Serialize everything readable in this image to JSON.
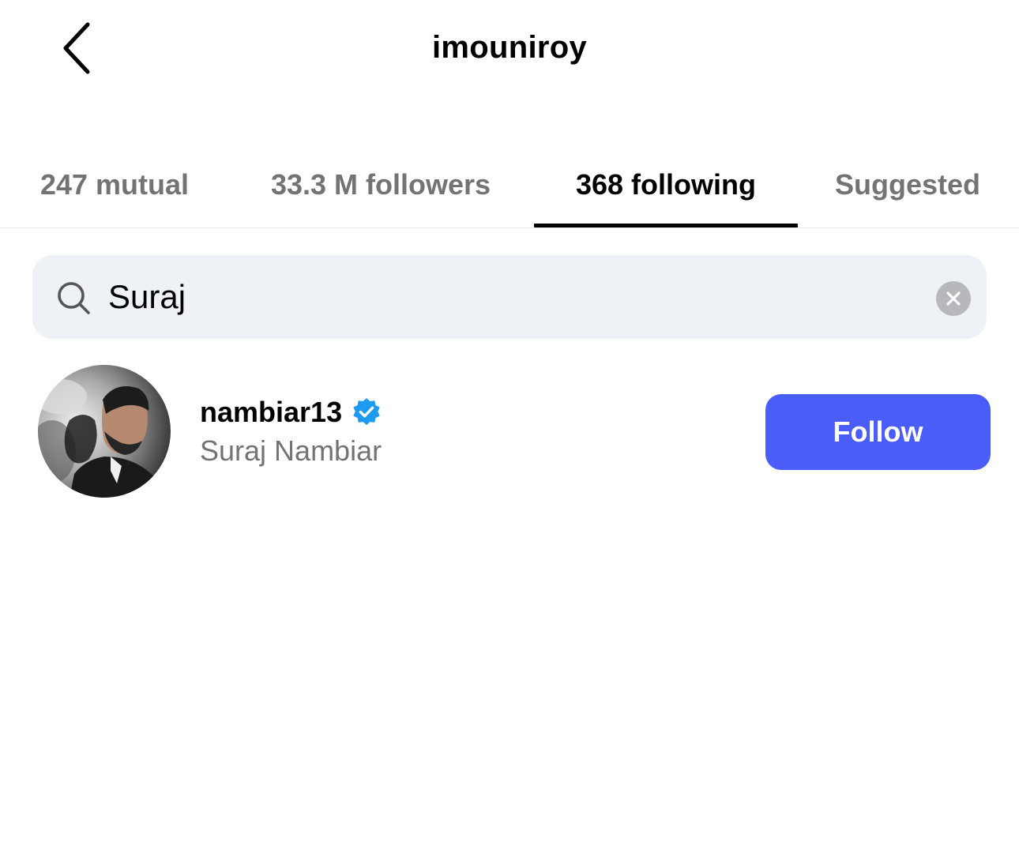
{
  "header": {
    "title": "imouniroy",
    "back_icon": "chevron-left-icon"
  },
  "tabs": [
    {
      "label": "247 mutual",
      "active": false
    },
    {
      "label": "33.3 M followers",
      "active": false
    },
    {
      "label": "368 following",
      "active": true
    },
    {
      "label": "Suggested",
      "active": false
    }
  ],
  "search": {
    "value": "Suraj",
    "icon": "search-icon",
    "clear_icon": "clear-icon"
  },
  "results": [
    {
      "username": "nambiar13",
      "full_name": "Suraj Nambiar",
      "verified": true,
      "follow_label": "Follow"
    }
  ],
  "colors": {
    "accent": "#4a5df9",
    "verified": "#1d9bf0",
    "muted_text": "#737373",
    "search_bg": "#eef1f5"
  }
}
